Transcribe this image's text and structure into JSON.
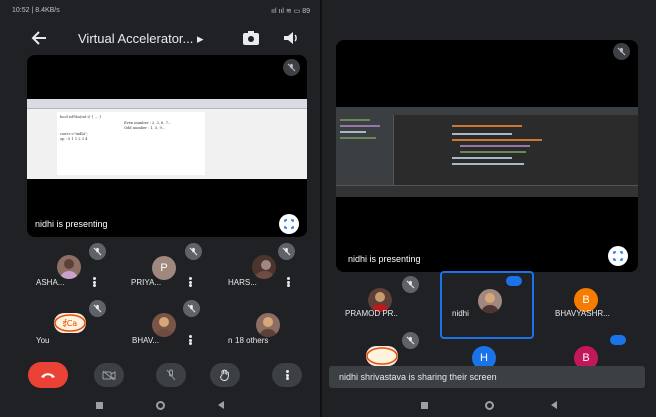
{
  "left": {
    "status": {
      "time": "10:52 | 8.4KB/s",
      "icons": "ııl ııl ≋ ▭ 89"
    },
    "appbar": {
      "title": "Virtual Accelerator... ▸"
    },
    "stage": {
      "presenting": "nidhi is presenting"
    },
    "participants": [
      {
        "name": "ASHA...",
        "avatar": "photo"
      },
      {
        "name": "PRIYA...",
        "initial": "P",
        "color": "#a1887f"
      },
      {
        "name": "HARS...",
        "avatar": "photo"
      },
      {
        "name": "You",
        "avatar": "photo"
      },
      {
        "name": "BHAV...",
        "avatar": "photo"
      },
      {
        "name": "n",
        "more": "18 others"
      }
    ],
    "doc_text": [
      "bool isFibo(int i) { ... }",
      "Even number : 2, 3, 6, 7...",
      "Odd number : 1, 5, 9...",
      "cout<<\"nidhi\";",
      "op : 0 1 1 2 3 4"
    ]
  },
  "right": {
    "stage": {
      "presenting": "nidhi is presenting"
    },
    "participants": [
      {
        "name": "PRAMOD PR..",
        "avatar": "photo"
      },
      {
        "name": "nidhi",
        "avatar": "photo"
      },
      {
        "name": "BHAVYASHR...",
        "initial": "B",
        "color": "#f57c00"
      },
      {
        "name": "",
        "avatar": "photo"
      },
      {
        "name": "",
        "initial": "H",
        "color": "#1a73e8"
      },
      {
        "name": "",
        "initial": "B",
        "color": "#c2185b"
      }
    ],
    "snackbar": "nidhi shrivastava is sharing their screen"
  }
}
